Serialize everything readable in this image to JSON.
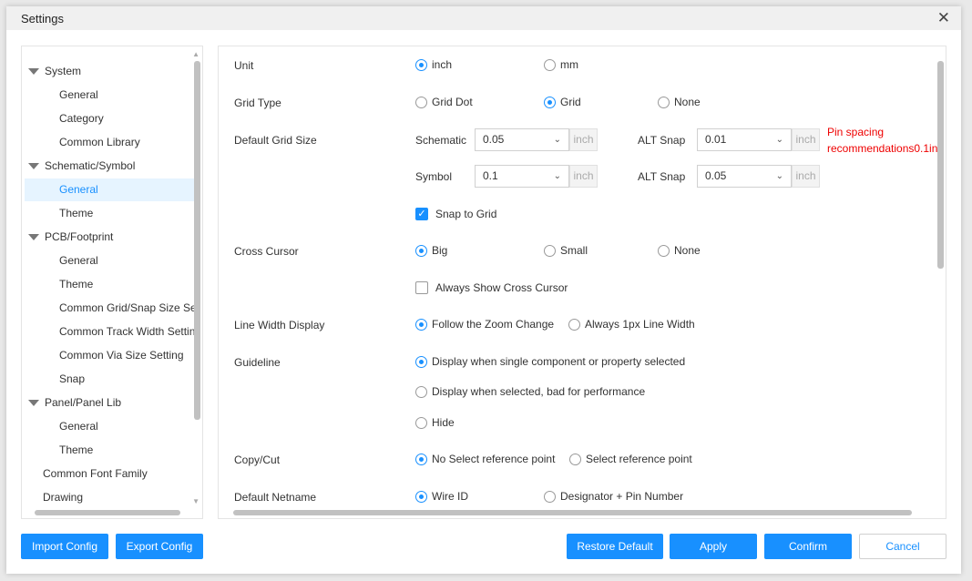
{
  "dialog": {
    "title": "Settings",
    "close_icon": "close-icon"
  },
  "sidebar": {
    "items": [
      {
        "label": "System",
        "level": 0
      },
      {
        "label": "General",
        "level": 1
      },
      {
        "label": "Category",
        "level": 1
      },
      {
        "label": "Common Library",
        "level": 1
      },
      {
        "label": "Schematic/Symbol",
        "level": 0
      },
      {
        "label": "General",
        "level": 1,
        "selected": true
      },
      {
        "label": "Theme",
        "level": 1
      },
      {
        "label": "PCB/Footprint",
        "level": 0
      },
      {
        "label": "General",
        "level": 1
      },
      {
        "label": "Theme",
        "level": 1
      },
      {
        "label": "Common Grid/Snap Size Se",
        "level": 1
      },
      {
        "label": "Common Track Width Settin",
        "level": 1
      },
      {
        "label": "Common Via Size Setting",
        "level": 1
      },
      {
        "label": "Snap",
        "level": 1
      },
      {
        "label": "Panel/Panel Lib",
        "level": 0
      },
      {
        "label": "General",
        "level": 1
      },
      {
        "label": "Theme",
        "level": 1
      },
      {
        "label": "Common Font Family",
        "level": 0,
        "leaf": true
      },
      {
        "label": "Drawing",
        "level": 0,
        "leaf": true
      }
    ]
  },
  "main": {
    "unit": {
      "label": "Unit",
      "options": [
        "inch",
        "mm"
      ],
      "selected": 0
    },
    "grid_type": {
      "label": "Grid Type",
      "options": [
        "Grid Dot",
        "Grid",
        "None"
      ],
      "selected": 1
    },
    "grid_size": {
      "label": "Default Grid Size",
      "schematic_label": "Schematic",
      "schematic_value": "0.05",
      "symbol_label": "Symbol",
      "symbol_value": "0.1",
      "alt_label": "ALT Snap",
      "alt_schematic": "0.01",
      "alt_symbol": "0.05",
      "unit": "inch",
      "hint_line1": "Pin spacing",
      "hint_line2": "recommendations0.1in"
    },
    "snap_to_grid": {
      "label": "Snap to Grid",
      "checked": true
    },
    "cross_cursor": {
      "label": "Cross Cursor",
      "options": [
        "Big",
        "Small",
        "None"
      ],
      "selected": 0
    },
    "always_show_cross": {
      "label": "Always Show Cross Cursor",
      "checked": false
    },
    "line_width": {
      "label": "Line Width Display",
      "options": [
        "Follow the Zoom Change",
        "Always 1px Line Width"
      ],
      "selected": 0
    },
    "guideline": {
      "label": "Guideline",
      "options": [
        "Display when single component or property selected",
        "Display when selected, bad for performance",
        "Hide"
      ],
      "selected": 0
    },
    "copy_cut": {
      "label": "Copy/Cut",
      "options": [
        "No Select reference point",
        "Select reference point"
      ],
      "selected": 0
    },
    "netname": {
      "label": "Default Netname",
      "options": [
        "Wire ID",
        "Designator + Pin Number"
      ],
      "selected": 0
    }
  },
  "footer": {
    "import": "Import Config",
    "export": "Export Config",
    "restore": "Restore Default",
    "apply": "Apply",
    "confirm": "Confirm",
    "cancel": "Cancel"
  },
  "colors": {
    "accent": "#1890ff",
    "hint": "#ee0000"
  }
}
